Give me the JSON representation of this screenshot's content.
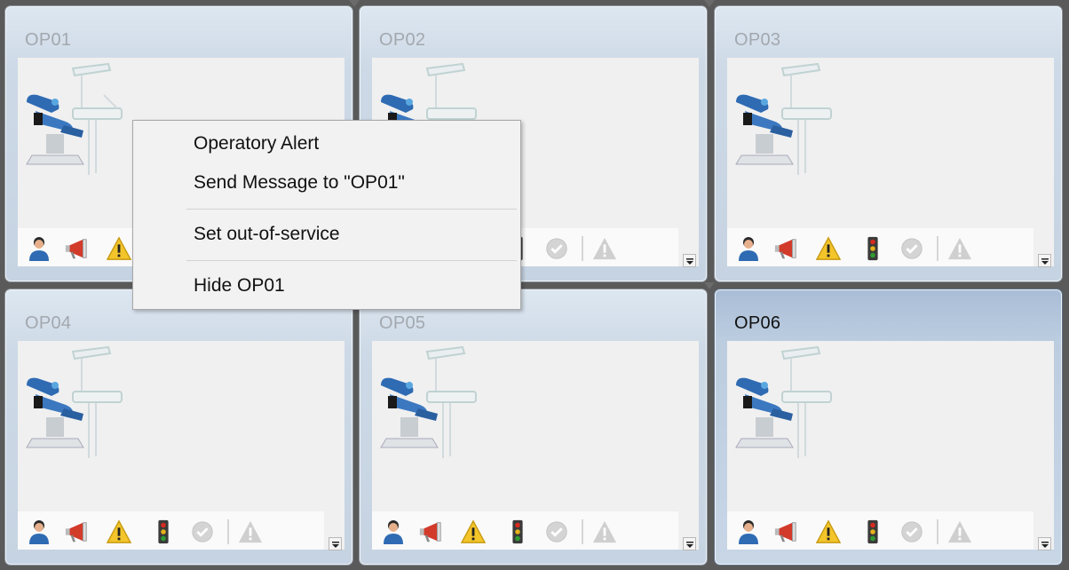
{
  "operatories": [
    {
      "name": "OP01",
      "active": false
    },
    {
      "name": "OP02",
      "active": false
    },
    {
      "name": "OP03",
      "active": false
    },
    {
      "name": "OP04",
      "active": false
    },
    {
      "name": "OP05",
      "active": false
    },
    {
      "name": "OP06",
      "active": true
    }
  ],
  "toolbar_icons": [
    "person-icon",
    "megaphone-icon",
    "warning-icon",
    "traffic-light-icon",
    "checkmark-icon",
    "alert-icon"
  ],
  "context_menu": {
    "items": [
      "Operatory Alert",
      "Send Message to \"OP01\"",
      "Set out-of-service",
      "Hide OP01"
    ]
  },
  "colors": {
    "accent_blue": "#2f6bb3",
    "warning_yellow": "#f3c52a",
    "megaphone_red": "#d23a2a"
  }
}
